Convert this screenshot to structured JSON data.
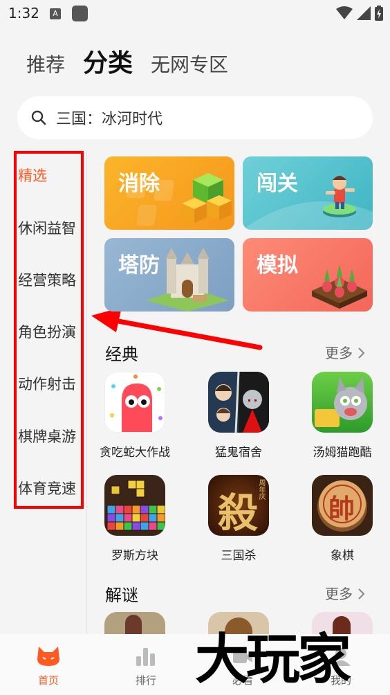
{
  "status": {
    "time": "1:32",
    "a_icon": "A"
  },
  "top_tabs": [
    {
      "label": "推荐",
      "active": false
    },
    {
      "label": "分类",
      "active": true
    },
    {
      "label": "无网专区",
      "active": false
    }
  ],
  "search": {
    "placeholder": "三国：冰河时代"
  },
  "sidebar": {
    "items": [
      {
        "label": "精选"
      },
      {
        "label": "休闲益智"
      },
      {
        "label": "经营策略"
      },
      {
        "label": "角色扮演"
      },
      {
        "label": "动作射击"
      },
      {
        "label": "棋牌桌游"
      },
      {
        "label": "体育竞速"
      }
    ]
  },
  "categories": [
    {
      "label": "消除",
      "color": "#f7a524"
    },
    {
      "label": "闯关",
      "color": "#5fc6cf"
    },
    {
      "label": "塔防",
      "color": "#8fb0cf"
    },
    {
      "label": "模拟",
      "color": "#fb7a68"
    }
  ],
  "sections": [
    {
      "title": "经典",
      "more": "更多",
      "games": [
        {
          "name": "贪吃蛇大作战"
        },
        {
          "name": "猛鬼宿舍"
        },
        {
          "name": "汤姆猫跑酷"
        },
        {
          "name": "罗斯方块"
        },
        {
          "name": "三国杀"
        },
        {
          "name": "象棋"
        }
      ]
    },
    {
      "title": "解谜",
      "more": "更多"
    }
  ],
  "nav": [
    {
      "label": "首页",
      "active": true
    },
    {
      "label": "排行",
      "active": false
    },
    {
      "label": "必看",
      "active": false
    },
    {
      "label": "我的",
      "active": false
    }
  ],
  "watermark": "大玩家",
  "sanguosha_badge": "周年庆",
  "sanguosha_char": "殺",
  "xiangqi_char": "帥",
  "accent": "#ff5a22"
}
